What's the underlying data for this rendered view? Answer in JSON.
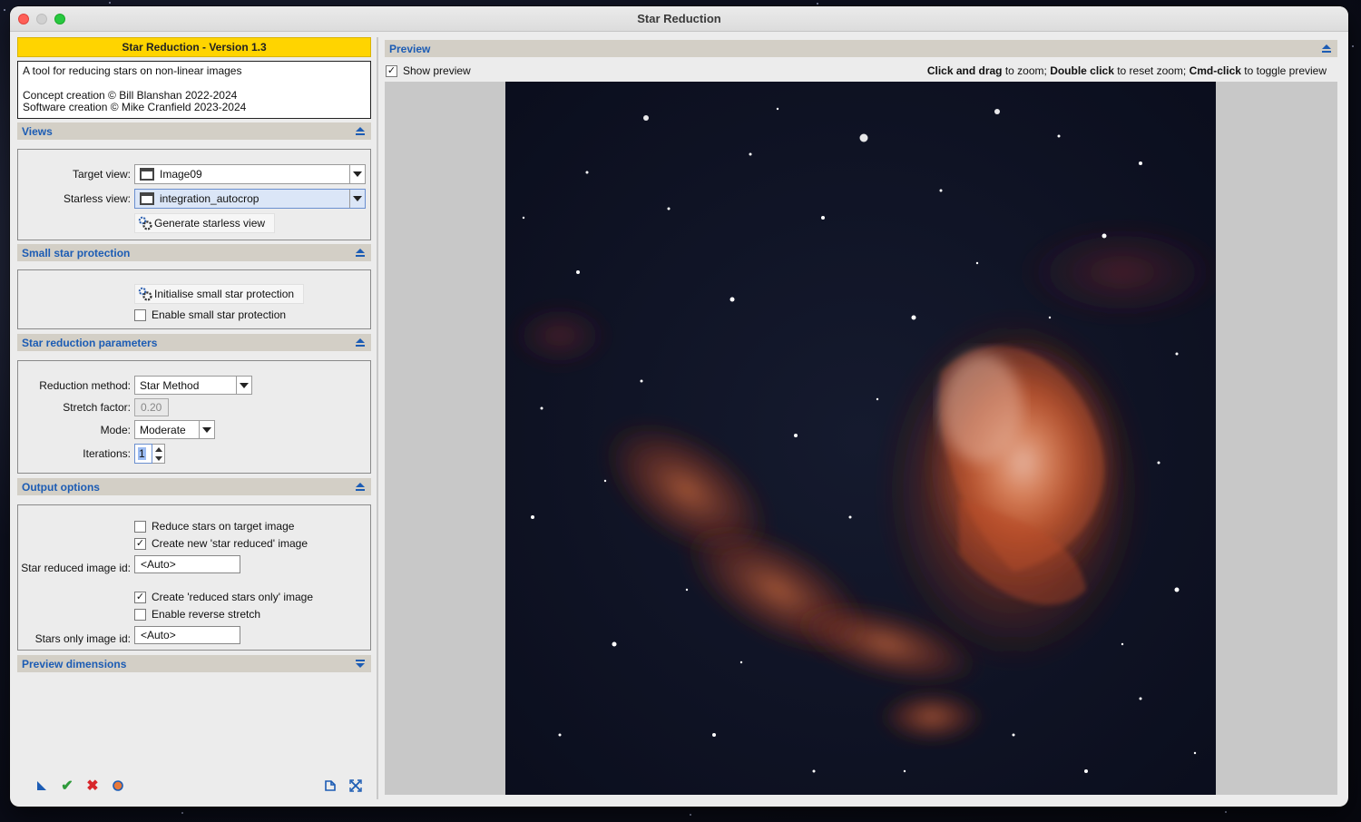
{
  "window": {
    "title": "Star Reduction"
  },
  "header": {
    "version": "Star Reduction - Version 1.3",
    "description": "A tool for reducing stars on non-linear images",
    "concept_credit": "Concept creation © Bill Blanshan 2022-2024",
    "software_credit": "Software creation © Mike Cranfield 2023-2024"
  },
  "views": {
    "title": "Views",
    "target_label": "Target view:",
    "target_value": "Image09",
    "starless_label": "Starless view:",
    "starless_value": "integration_autocrop",
    "generate_button": "Generate starless view"
  },
  "small_star": {
    "title": "Small star protection",
    "init_button": "Initialise small star protection",
    "enable_label": "Enable small star protection",
    "enable_checked": false
  },
  "params": {
    "title": "Star reduction parameters",
    "method_label": "Reduction method:",
    "method_value": "Star Method",
    "stretch_label": "Stretch factor:",
    "stretch_value": "0.20",
    "mode_label": "Mode:",
    "mode_value": "Moderate",
    "iterations_label": "Iterations:",
    "iterations_value": "1"
  },
  "output": {
    "title": "Output options",
    "reduce_target_label": "Reduce stars on target image",
    "reduce_target_checked": false,
    "create_reduced_label": "Create new 'star reduced' image",
    "create_reduced_checked": true,
    "reduced_id_label": "Star reduced image id:",
    "reduced_id_value": "<Auto>",
    "create_stars_only_label": "Create 'reduced stars only' image",
    "create_stars_only_checked": true,
    "reverse_stretch_label": "Enable reverse stretch",
    "reverse_stretch_checked": false,
    "stars_only_id_label": "Stars only image id:",
    "stars_only_id_value": "<Auto>"
  },
  "preview_dims": {
    "title": "Preview dimensions"
  },
  "preview": {
    "title": "Preview",
    "show_label": "Show preview",
    "show_checked": true,
    "hint_click_drag": "Click and drag",
    "hint_zoom": " to zoom; ",
    "hint_double": "Double click",
    "hint_reset": " to reset zoom; ",
    "hint_cmd": "Cmd-click",
    "hint_toggle": " to toggle preview"
  },
  "colors": {
    "accent_blue": "#1c5cb4",
    "version_bar": "#ffd400",
    "section_header": "#d3cfc6",
    "check_green": "#2e9a3a",
    "cancel_red": "#d8262a"
  }
}
